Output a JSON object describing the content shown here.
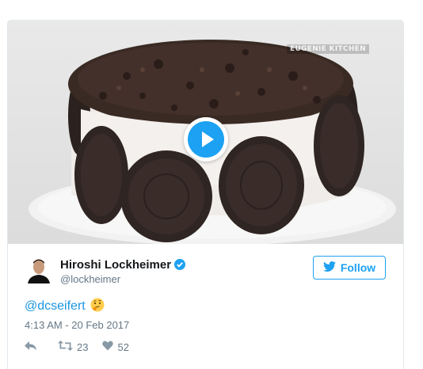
{
  "media": {
    "watermark": "EUGENIE KITCHEN",
    "play_icon": "play-icon"
  },
  "user": {
    "display_name": "Hiroshi Lockheimer",
    "handle": "@lockheimer",
    "verified_icon": "verified-badge-icon"
  },
  "follow": {
    "label": "Follow",
    "icon": "twitter-bird-icon"
  },
  "tweet": {
    "mention": "@dcseifert",
    "emoji": "thinking-face-emoji",
    "timestamp": "4:13 AM - 20 Feb 2017"
  },
  "actions": {
    "reply_icon": "reply-icon",
    "retweet_icon": "retweet-icon",
    "retweet_count": "23",
    "like_icon": "heart-icon",
    "like_count": "52"
  },
  "colors": {
    "accent": "#1da1f2",
    "link": "#1b95e0",
    "text": "#14171a",
    "secondary": "#657786",
    "cookie": "#2f2522",
    "cream": "#f4f1ee"
  }
}
